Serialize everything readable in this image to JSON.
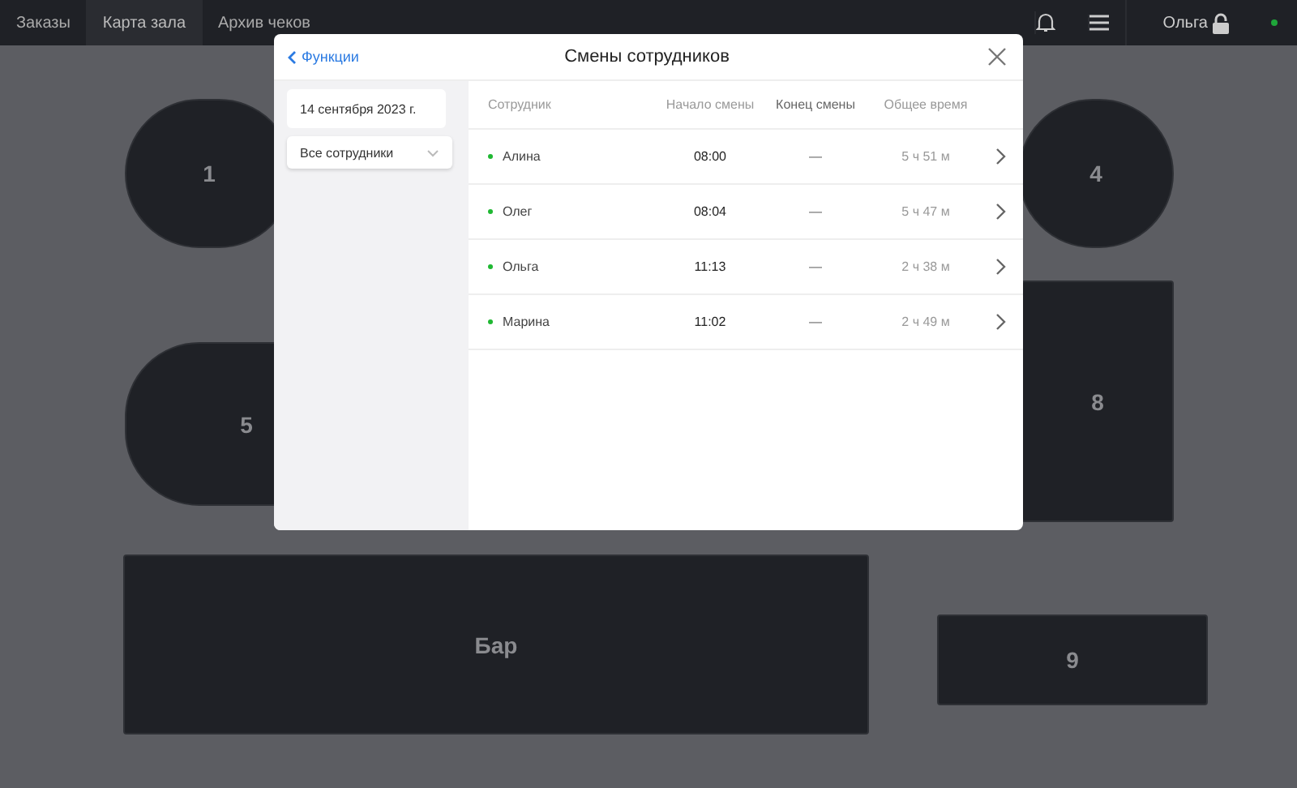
{
  "tabs": [
    {
      "label": "Заказы",
      "selected": false
    },
    {
      "label": "Карта зала",
      "selected": true
    },
    {
      "label": "Архив чеков",
      "selected": false
    }
  ],
  "user": {
    "name": "Ольга"
  },
  "floor": {
    "tables": [
      {
        "label": "1",
        "kind": "round"
      },
      {
        "label": "4",
        "kind": "round"
      },
      {
        "label": "5",
        "kind": "round"
      },
      {
        "label": "8",
        "kind": "square"
      },
      {
        "label": "Бар",
        "kind": "square"
      },
      {
        "label": "9",
        "kind": "square"
      }
    ]
  },
  "dialog": {
    "back_label": "Функции",
    "title": "Смены сотрудников",
    "date": "14 сентября 2023 г.",
    "filter": "Все сотрудники",
    "columns": [
      "Сотрудник",
      "Начало смены",
      "Конец смены",
      "Общее время"
    ],
    "rows": [
      {
        "name": "Алина",
        "start": "08:00",
        "end": "—",
        "total": "5 ч 51 м",
        "active": true
      },
      {
        "name": "Олег",
        "start": "08:04",
        "end": "—",
        "total": "5 ч 47 м",
        "active": true
      },
      {
        "name": "Ольга",
        "start": "11:13",
        "end": "—",
        "total": "2 ч 38 м",
        "active": true
      },
      {
        "name": "Марина",
        "start": "11:02",
        "end": "—",
        "total": "2 ч 49 м",
        "active": true
      }
    ]
  }
}
